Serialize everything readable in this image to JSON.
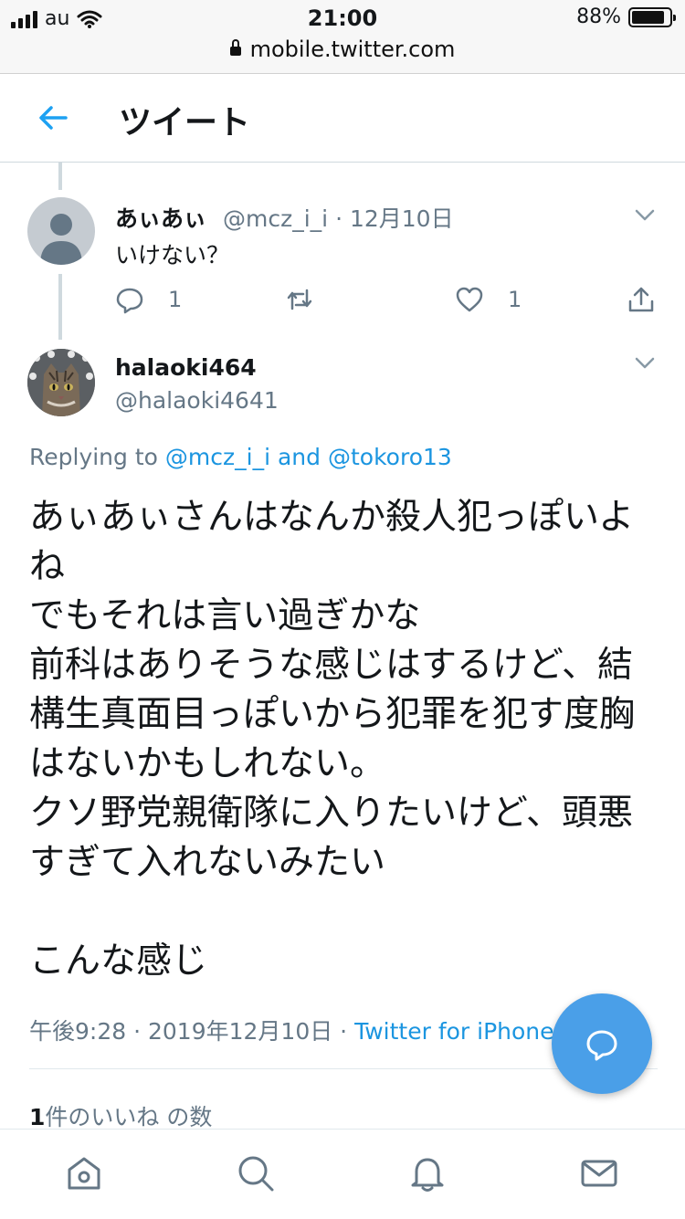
{
  "status_bar": {
    "carrier": "au",
    "time": "21:00",
    "battery": "88%",
    "url": "mobile.twitter.com"
  },
  "header": {
    "title": "ツイート"
  },
  "parent_tweet": {
    "name": "あぃあぃ",
    "handle": "@mcz_i_i",
    "date": "12月10日",
    "text": "いけない？",
    "reply_count": "1",
    "like_count": "1"
  },
  "tweet": {
    "name": "halaoki464",
    "handle": "@halaoki4641",
    "replying_prefix": "Replying to",
    "reply_user1": "@mcz_i_i",
    "reply_and": "and",
    "reply_user2": "@tokoro13",
    "text": "あぃあぃさんはなんか殺人犯っぽいよね\nでもそれは言い過ぎかな\n前科はありそうな感じはするけど、結構生真面目っぽいから犯罪を犯す度胸はないかもしれない。\nクソ野党親衛隊に入りたいけど、頭悪すぎて入れないみたい\n\nこんな感じ",
    "time": "午後9:28",
    "date": "2019年12月10日",
    "source": "Twitter for iPhone",
    "likes_count": "1",
    "likes_label": "件のいいね の数"
  },
  "colors": {
    "accent": "#1b95e0",
    "fab": "#4a9fe8",
    "muted": "#657786"
  },
  "icons": {
    "back": "arrow-left-icon",
    "caret": "chevron-down-icon",
    "reply": "reply-icon",
    "retweet": "retweet-icon",
    "like": "heart-icon",
    "share": "share-icon",
    "compose": "compose-reply-icon",
    "tabs": [
      "home-icon",
      "search-icon",
      "notifications-icon",
      "messages-icon"
    ]
  }
}
